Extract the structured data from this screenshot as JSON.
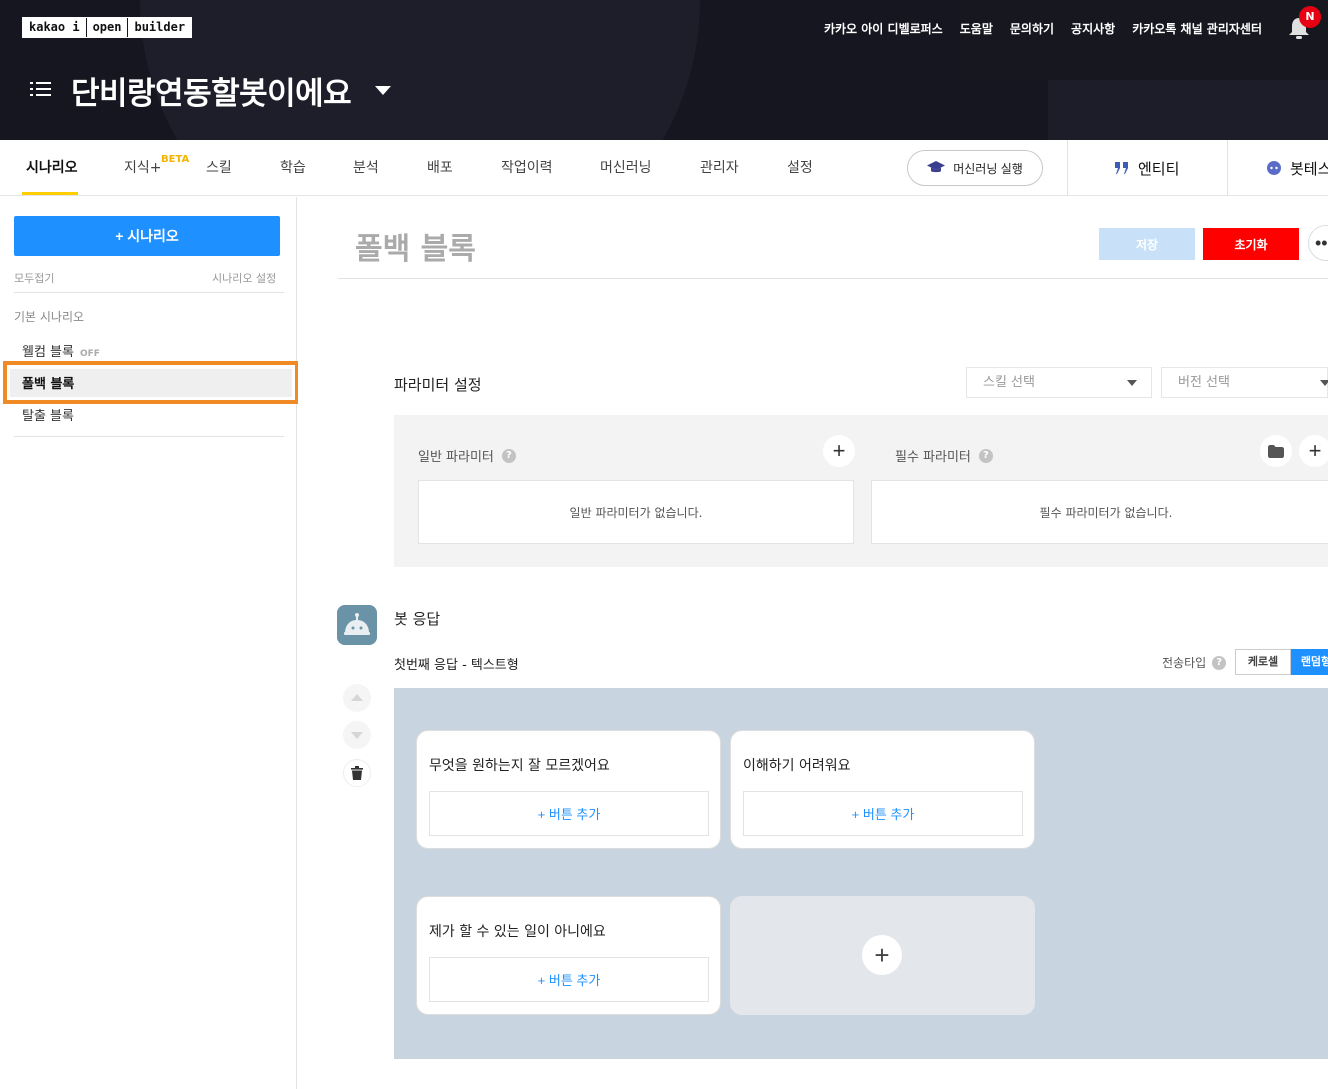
{
  "header": {
    "logo": [
      "kakao i",
      "open",
      "builder"
    ],
    "links": [
      "카카오 아이 디벨로퍼스",
      "도움말",
      "문의하기",
      "공지사항",
      "카카오톡 채널 관리자센터"
    ],
    "notification_badge": "N",
    "bot_name": "단비랑연동할봇이에요"
  },
  "nav": {
    "tabs": [
      "시나리오",
      "지식+",
      "스킬",
      "학습",
      "분석",
      "배포",
      "작업이력",
      "머신러닝",
      "관리자",
      "설정"
    ],
    "beta_label": "BETA",
    "ml_button": "머신러닝 실행",
    "entity": "엔티티",
    "bot_test": "봇테스"
  },
  "sidebar": {
    "add_button": "+ 시나리오",
    "collapse_all": "모두접기",
    "scenario_settings": "시나리오 설정",
    "section_title": "기본 시나리오",
    "items": [
      {
        "label": "웰컴 블록",
        "status": "OFF"
      },
      {
        "label": "폴백 블록",
        "status": ""
      },
      {
        "label": "탈출 블록",
        "status": ""
      }
    ]
  },
  "main": {
    "block_title": "폴백 블록",
    "save_label": "저장",
    "reset_label": "초기화",
    "more_label": "••",
    "params": {
      "title": "파라미터 설정",
      "skill_select": "스킬 선택",
      "version_select": "버전 선택",
      "general_title": "일반 파라미터",
      "general_empty": "일반 파라미터가 없습니다.",
      "required_title": "필수 파라미터",
      "required_empty": "필수 파라미터가 없습니다.",
      "help_glyph": "?"
    },
    "response": {
      "title": "봇 응답",
      "subtitle": "첫번째 응답 - 텍스트형",
      "send_type_label": "전송타입",
      "carousel": "케로셀",
      "random": "랜덤형",
      "cards": [
        {
          "text": "무엇을 원하는지 잘 모르겠어요",
          "button": "+ 버튼 추가"
        },
        {
          "text": "이해하기 어려워요",
          "button": "+ 버튼 추가"
        },
        {
          "text": "제가 할 수 있는 일이 아니에요",
          "button": "+ 버튼 추가"
        }
      ]
    }
  },
  "colors": {
    "header_bg": "#15161f",
    "accent_blue": "#1e90ff",
    "reset_red": "#ff0000",
    "tab_underline": "#ffcd00",
    "highlight_orange": "#f08a24"
  }
}
